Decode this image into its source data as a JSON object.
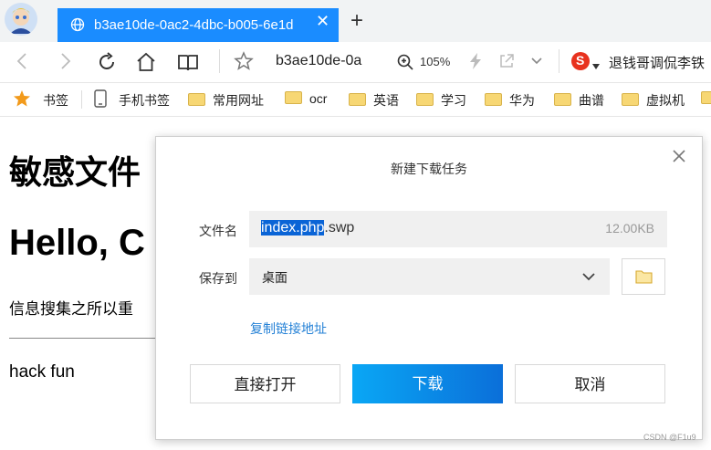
{
  "tab": {
    "title": "b3ae10de-0ac2-4dbc-b005-6e1d",
    "close": "✕"
  },
  "newtab": "+",
  "address": {
    "url": "b3ae10de-0a",
    "zoom": "105%"
  },
  "ticker": "退钱哥调侃李铁",
  "bookmarks": [
    {
      "label": "书签",
      "icon": "star-icon"
    },
    {
      "label": "手机书签",
      "icon": "phone-icon"
    },
    {
      "label": "常用网址",
      "icon": "folder-icon"
    },
    {
      "label": "ocr",
      "icon": "folder-icon"
    },
    {
      "label": "英语",
      "icon": "folder-icon"
    },
    {
      "label": "学习",
      "icon": "folder-icon"
    },
    {
      "label": "华为",
      "icon": "folder-icon"
    },
    {
      "label": "曲谱",
      "icon": "folder-icon"
    },
    {
      "label": "虚拟机",
      "icon": "folder-icon"
    }
  ],
  "page": {
    "heading1": "敏感文件",
    "heading2": "Hello, C",
    "paragraph": "信息搜集之所以重",
    "body_text": "hack fun"
  },
  "dialog": {
    "title": "新建下载任务",
    "filename_label": "文件名",
    "filename_selected": "index.php",
    "filename_rest": ".swp",
    "filesize": "12.00KB",
    "saveto_label": "保存到",
    "saveto_value": "桌面",
    "copy_link": "复制链接地址",
    "open_button": "直接打开",
    "download_button": "下载",
    "cancel_button": "取消"
  },
  "watermark": "CSDN @F1u9",
  "colors": {
    "tab_active": "#1a8cff",
    "download_button": "#0b8af0",
    "link": "#2481d6",
    "selection": "#0a64d6"
  }
}
